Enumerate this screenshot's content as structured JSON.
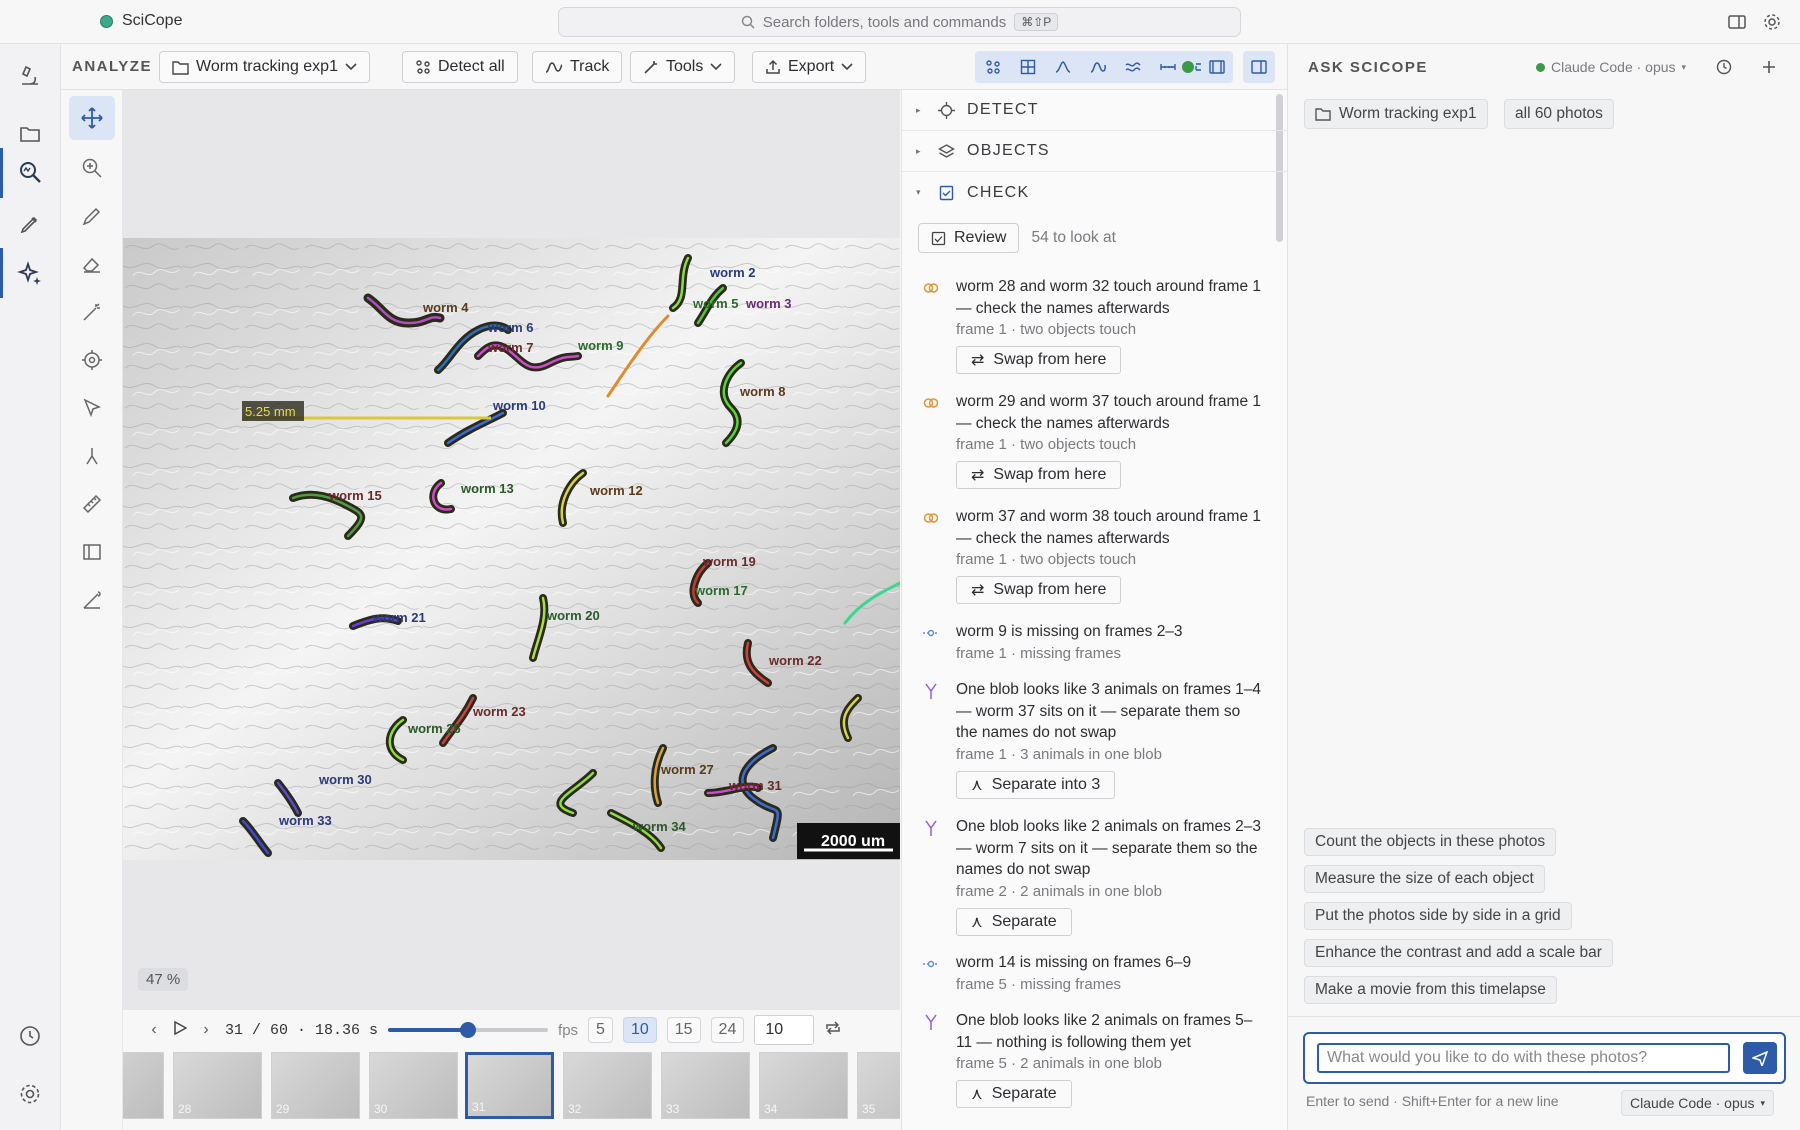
{
  "app": {
    "name": "SciCope"
  },
  "search": {
    "placeholder": "Search folders, tools and commands",
    "shortcut": "⌘⇧P"
  },
  "toolbar": {
    "section_label": "ANALYZE",
    "folder_label": "Worm tracking exp1",
    "detect_label": "Detect all",
    "track_label": "Track",
    "tools_label": "Tools",
    "export_label": "Export"
  },
  "view": {
    "measure_label": "5.25 mm",
    "scalebar_label": "2000 um",
    "zoom_label": "47 %",
    "worms": [
      "worm 2",
      "worm 3",
      "worm 4",
      "worm 5",
      "worm 6",
      "worm 7",
      "worm 8",
      "worm 9",
      "worm 10",
      "worm 12",
      "worm 13",
      "worm 15",
      "worm 17",
      "worm 19",
      "worm 20",
      "worm 21",
      "worm 22",
      "worm 23",
      "worm 26",
      "worm 27",
      "worm 30",
      "worm 31",
      "worm 33",
      "worm 34"
    ]
  },
  "playback": {
    "frame": "31 / 60 · 18.36 s",
    "frame_progress": 0.5,
    "fps_label": "fps",
    "fps_options": [
      "5",
      "10",
      "15",
      "24"
    ],
    "fps_selected": "10",
    "fps_value": "10"
  },
  "filmstrip": {
    "frames": [
      "28",
      "29",
      "30",
      "31",
      "32",
      "33",
      "34",
      "35"
    ],
    "selected": "31"
  },
  "panel": {
    "sections": [
      "DETECT",
      "OBJECTS",
      "CHECK"
    ],
    "review_label": "Review",
    "review_count": "54 to look at",
    "issues": [
      {
        "text": "worm 28 and worm 32 touch around frame 1 — check the names afterwards",
        "sub": "frame 1 · two objects touch",
        "action": "Swap from here",
        "icon": "touch-icon"
      },
      {
        "text": "worm 29 and worm 37 touch around frame 1 — check the names afterwards",
        "sub": "frame 1 · two objects touch",
        "action": "Swap from here",
        "icon": "touch-icon"
      },
      {
        "text": "worm 37 and worm 38 touch around frame 1 — check the names afterwards",
        "sub": "frame 1 · two objects touch",
        "action": "Swap from here",
        "icon": "touch-icon"
      },
      {
        "text": "worm 9 is missing on frames 2–3",
        "sub": "frame 1 · missing frames",
        "action": "",
        "icon": "missing-icon"
      },
      {
        "text": "One blob looks like 3 animals on frames 1–4 — worm 37 sits on it — separate them so the names do not swap",
        "sub": "frame 1 · 3 animals in one blob",
        "action": "Separate into 3",
        "icon": "split-icon"
      },
      {
        "text": "One blob looks like 2 animals on frames 2–3 — worm 7 sits on it — separate them so the names do not swap",
        "sub": "frame 2 · 2 animals in one blob",
        "action": "Separate",
        "icon": "split-icon"
      },
      {
        "text": "worm 14 is missing on frames 6–9",
        "sub": "frame 5 · missing frames",
        "action": "",
        "icon": "missing-icon"
      },
      {
        "text": "One blob looks like 2 animals on frames 5–11 — nothing is following them yet",
        "sub": "frame 5 · 2 animals in one blob",
        "action": "Separate",
        "icon": "split-icon"
      }
    ]
  },
  "chat": {
    "title": "ASK SCICOPE",
    "model": "Claude Code · opus",
    "chips": [
      "Worm tracking exp1",
      "all 60 photos"
    ],
    "suggestions": [
      "Count the objects in these photos",
      "Measure the size of each object",
      "Put the photos side by side in a grid",
      "Enhance the contrast and add a scale bar",
      "Make a movie from this timelapse"
    ],
    "input_placeholder": "What would you like to do with these photos?",
    "hint": "Enter to send · Shift+Enter for a new line"
  },
  "colors": {
    "accent": "#2d5ba8",
    "accent_bg": "#dbe5f5",
    "status_green": "#3a9a48"
  }
}
